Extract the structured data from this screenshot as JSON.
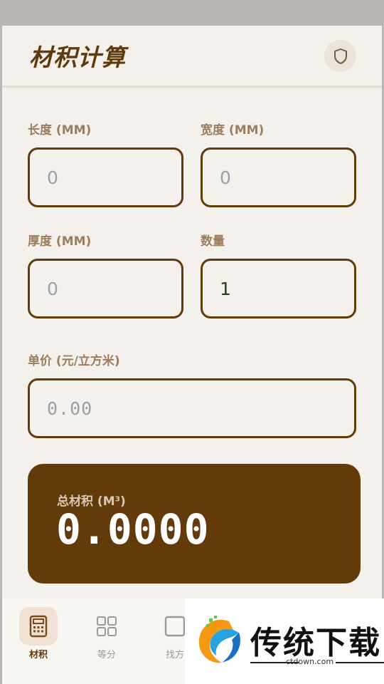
{
  "app": {
    "title": "材积计算"
  },
  "fields": {
    "length": {
      "label": "长度 (MM)",
      "placeholder": "0",
      "value": ""
    },
    "width": {
      "label": "宽度 (MM)",
      "placeholder": "0",
      "value": ""
    },
    "thickness": {
      "label": "厚度 (MM)",
      "placeholder": "0",
      "value": ""
    },
    "quantity": {
      "label": "数量",
      "placeholder": "",
      "value": "1"
    },
    "unit_price": {
      "label": "单价 (元/立方米)",
      "placeholder": "0.00",
      "value": ""
    }
  },
  "result": {
    "label": "总材积 (M³)",
    "value": "0.0000"
  },
  "nav": {
    "items": [
      {
        "label": "材积",
        "icon": "calculator-icon",
        "active": true
      },
      {
        "label": "等分",
        "icon": "grid-icon",
        "active": false
      },
      {
        "label": "找方",
        "icon": "square-icon",
        "active": false
      }
    ]
  },
  "watermark": {
    "brand": "传统下载",
    "url": "ctdown.com"
  },
  "colors": {
    "primary": "#633a0a",
    "background": "#f4f1ec",
    "label": "#9b7e61"
  }
}
